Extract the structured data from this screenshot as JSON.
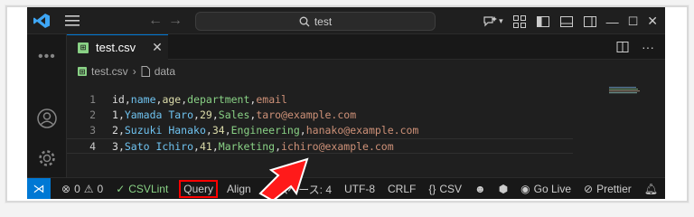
{
  "search": {
    "text": "test"
  },
  "tab": {
    "label": "test.csv",
    "badge": "CSV"
  },
  "breadcrumb": {
    "file": "test.csv",
    "symbol": "data"
  },
  "lines": [
    {
      "num": "1",
      "tokens": [
        "id",
        "name",
        "age",
        "department",
        "email"
      ]
    },
    {
      "num": "2",
      "tokens": [
        "1",
        "Yamada Taro",
        "29",
        "Sales",
        "taro@example.com"
      ]
    },
    {
      "num": "3",
      "tokens": [
        "2",
        "Suzuki Hanako",
        "34",
        "Engineering",
        "hanako@example.com"
      ]
    },
    {
      "num": "4",
      "tokens": [
        "3",
        "Sato Ichiro",
        "41",
        "Marketing",
        "ichiro@example.com"
      ]
    }
  ],
  "status": {
    "errors": "0",
    "warnings": "0",
    "csvlint": "CSVLint",
    "query": "Query",
    "align": "Align",
    "spaces": "スペース: 4",
    "encoding": "UTF-8",
    "eol": "CRLF",
    "lang": "CSV",
    "golive": "Go Live",
    "prettier": "Prettier"
  },
  "colors": {
    "accent": "#0078d4",
    "highlight": "#ff0000"
  }
}
